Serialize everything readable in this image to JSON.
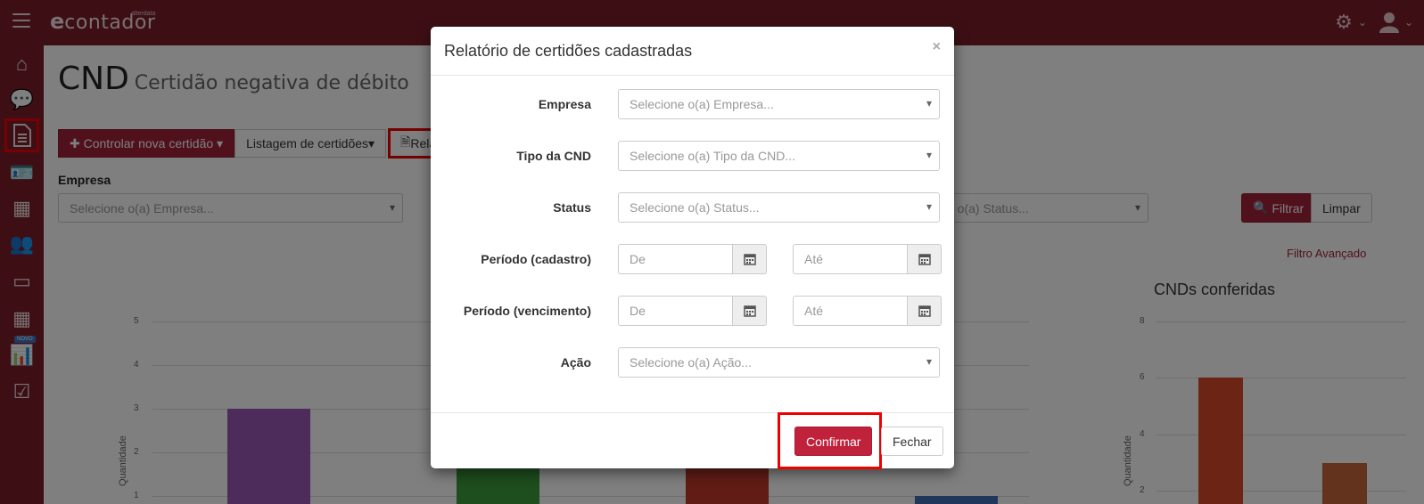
{
  "app": {
    "logo_e": "e",
    "logo_word": "contador",
    "logo_brand": "alterdata"
  },
  "page": {
    "title": "CND",
    "subtitle": "Certidão negativa de débito"
  },
  "toolbar": {
    "new_label": "Controlar nova certidão",
    "list_label": "Listagem de certidões",
    "report_label": "Rela"
  },
  "filters": {
    "empresa_label": "Empresa",
    "empresa_placeholder": "Selecione o(a) Empresa...",
    "status_placeholder": "e o(a) Status...",
    "filter_button": "Filtrar",
    "clear_button": "Limpar",
    "advanced_link": "Filtro Avançado"
  },
  "sidebar": {
    "novo_badge": "NOVO"
  },
  "chart_data": [
    {
      "type": "bar",
      "ylabel": "Quantidade",
      "ylim": [
        0,
        5
      ],
      "yticks": [
        "5",
        "4",
        "3",
        "2",
        "1"
      ],
      "values": [
        3,
        4,
        2,
        1
      ],
      "colors": [
        "#9b59b6",
        "#3d9a3d",
        "#c0392b",
        "#3e6fb5"
      ]
    },
    {
      "type": "bar",
      "title": "CNDs conferidas",
      "ylabel": "Quantidade",
      "ylim": [
        0,
        8
      ],
      "yticks": [
        "8",
        "6",
        "4",
        "2"
      ],
      "values": [
        6,
        3
      ],
      "colors": [
        "#d9482b",
        "#c8663a"
      ]
    }
  ],
  "modal": {
    "title": "Relatório de certidões cadastradas",
    "close_symbol": "×",
    "fields": {
      "empresa_label": "Empresa",
      "empresa_placeholder": "Selecione o(a) Empresa...",
      "tipo_label": "Tipo da CND",
      "tipo_placeholder": "Selecione o(a) Tipo da CND...",
      "status_label": "Status",
      "status_placeholder": "Selecione o(a) Status...",
      "periodo_cadastro_label": "Período (cadastro)",
      "periodo_vencimento_label": "Período (vencimento)",
      "de_placeholder": "De",
      "ate_placeholder": "Até",
      "acao_label": "Ação",
      "acao_placeholder": "Selecione o(a) Ação..."
    },
    "confirm_label": "Confirmar",
    "close_label": "Fechar"
  }
}
